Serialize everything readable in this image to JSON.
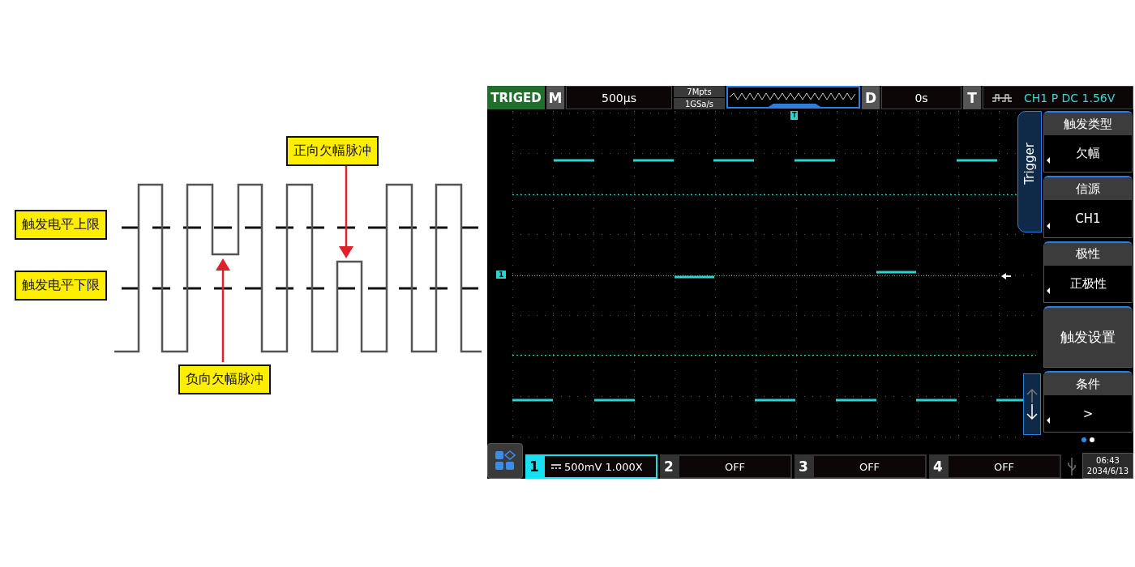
{
  "diagram": {
    "levels": [
      {
        "label": "触发电平上限"
      },
      {
        "label": "触发电平下限"
      }
    ],
    "callouts": [
      {
        "text": "正向欠幅脉冲"
      },
      {
        "text": "负向欠幅脉冲"
      }
    ]
  },
  "scope": {
    "status": "TRIGED",
    "timebase": {
      "key": "M",
      "value": "500µs"
    },
    "memory": "7Mpts",
    "sample_rate": "1GSa/s",
    "delay": {
      "key": "D",
      "value": "0s"
    },
    "trigger": {
      "key": "T",
      "value": "CH1 P DC 1.56V"
    },
    "trigger_marker": "T",
    "channel_marker": "1",
    "side_tab": "Trigger",
    "menu": [
      {
        "kind": "option",
        "label": "触发类型",
        "value": "欠幅"
      },
      {
        "kind": "option",
        "label": "信源",
        "value": "CH1"
      },
      {
        "kind": "option",
        "label": "极性",
        "value": "正极性"
      },
      {
        "kind": "action",
        "label": "触发设置"
      },
      {
        "kind": "option",
        "label": "条件",
        "value": ">"
      }
    ],
    "page_dots": [
      {
        "selected": true
      },
      {
        "selected": false
      }
    ],
    "channels": [
      {
        "number": "1",
        "value": "500mV 1.000X",
        "selected": true
      },
      {
        "number": "2",
        "value": "OFF",
        "selected": false
      },
      {
        "number": "3",
        "value": "OFF",
        "selected": false
      },
      {
        "number": "4",
        "value": "OFF",
        "selected": false
      }
    ],
    "time": "06:43",
    "date": "2034/6/13"
  }
}
